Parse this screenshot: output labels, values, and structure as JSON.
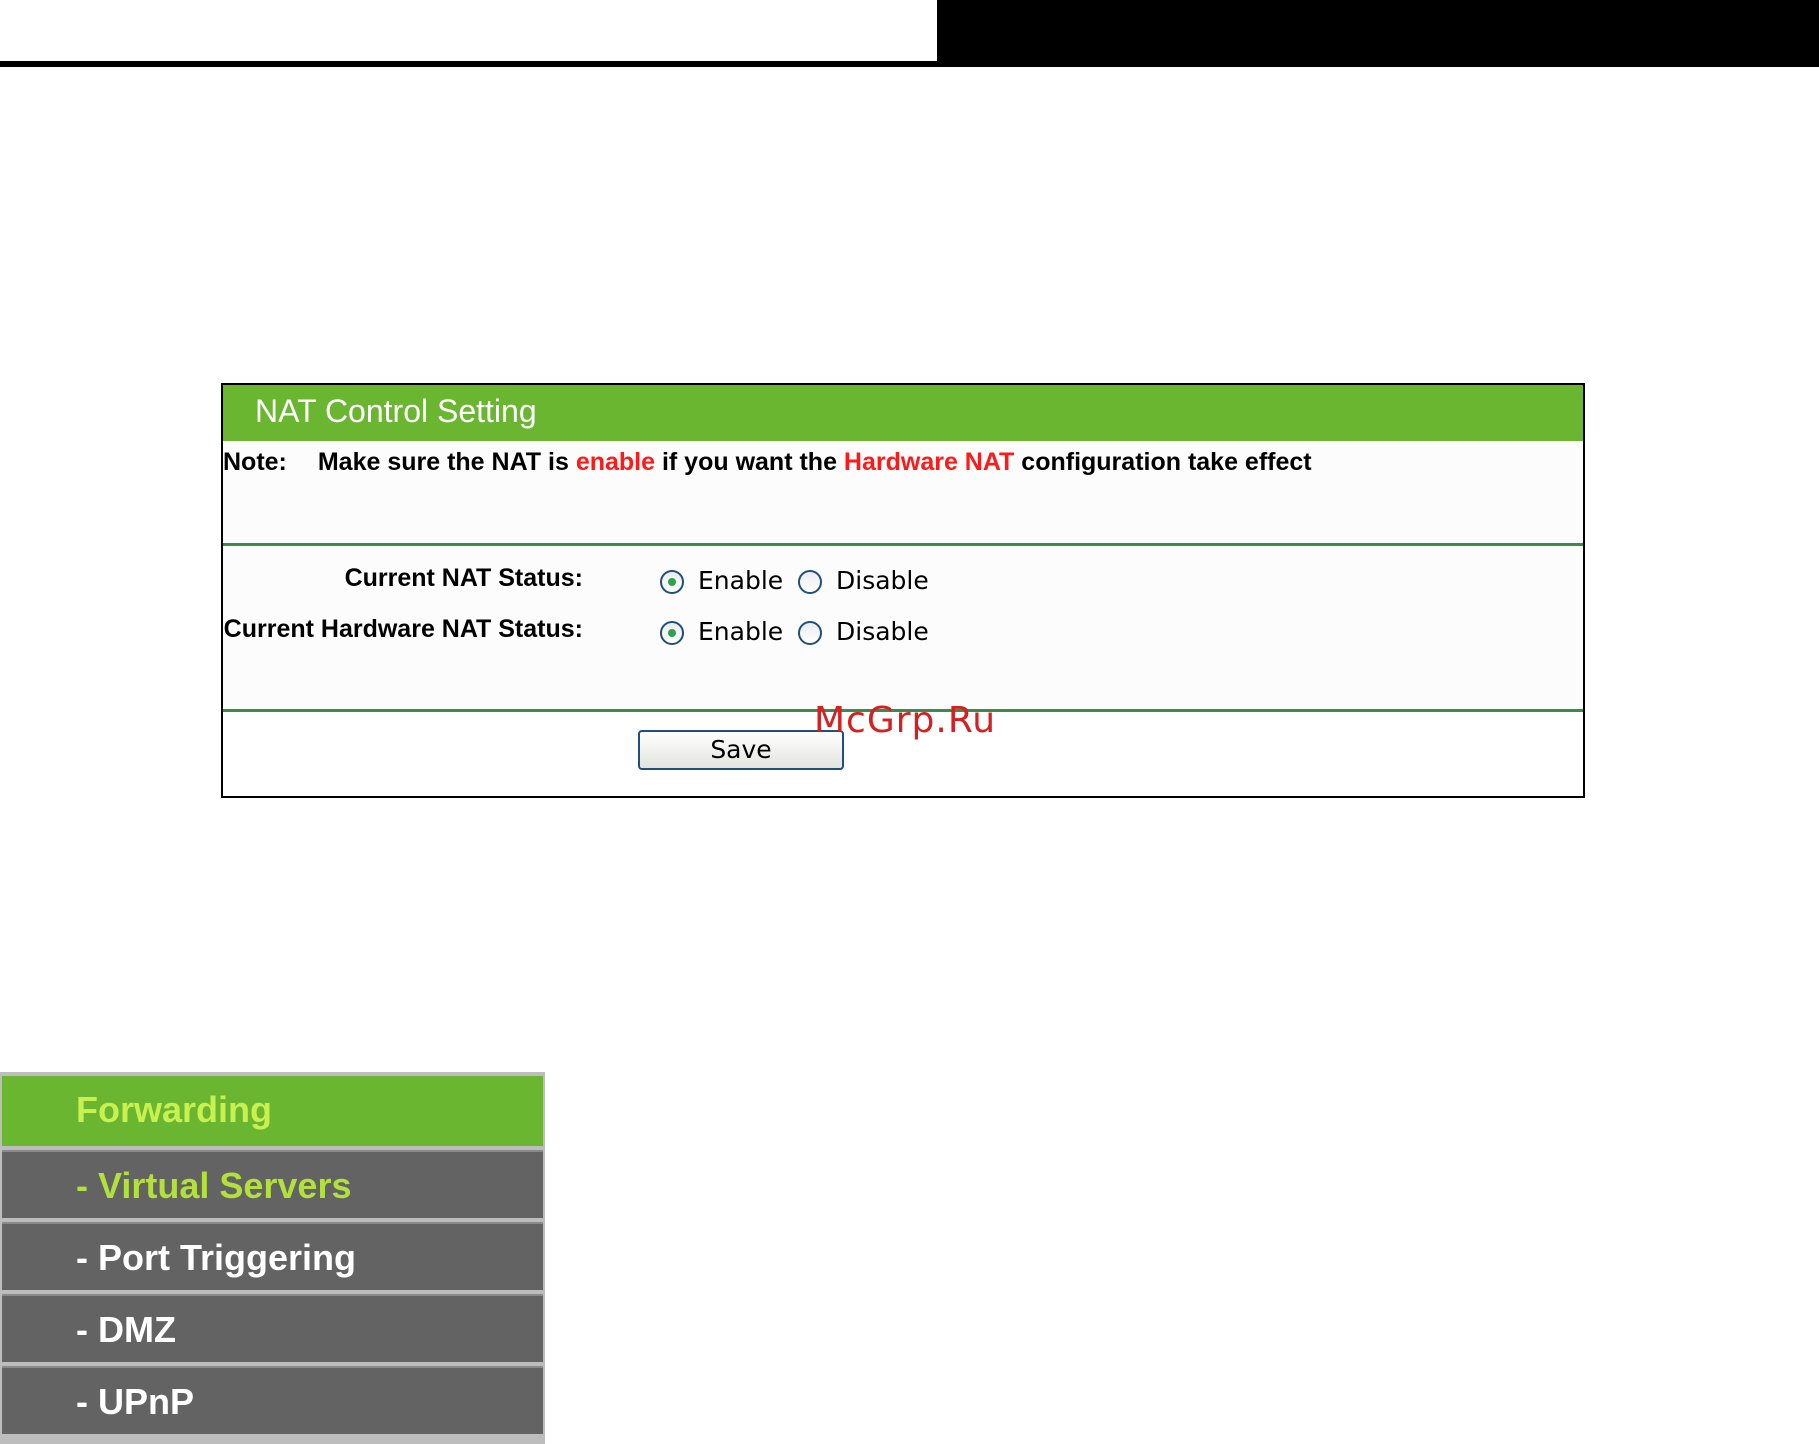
{
  "panel": {
    "title": "NAT Control Setting",
    "note": {
      "label": "Note:",
      "text_1": "Make sure the NAT is",
      "highlight_1": "enable",
      "text_2": "if you want the",
      "highlight_2": "Hardware NAT",
      "text_3": "configuration take effect"
    },
    "rows": [
      {
        "label": "Current NAT Status:",
        "option_enable": "Enable",
        "option_disable": "Disable",
        "selected": "Enable"
      },
      {
        "label": "Current Hardware NAT Status:",
        "option_enable": "Enable",
        "option_disable": "Disable",
        "selected": "Enable"
      }
    ],
    "save_label": "Save"
  },
  "watermark": "McGrp.Ru",
  "sidebar": {
    "items": [
      {
        "label": "Forwarding",
        "state": "active"
      },
      {
        "label": "- Virtual Servers",
        "state": "highlight"
      },
      {
        "label": "- Port Triggering",
        "state": "normal"
      },
      {
        "label": "- DMZ",
        "state": "normal"
      },
      {
        "label": "- UPnP",
        "state": "normal"
      }
    ]
  },
  "colors": {
    "accent_green": "#6ab630",
    "note_red": "#ff1a1a",
    "menu_gray": "#636363",
    "divider_green": "#3e8a4a"
  }
}
